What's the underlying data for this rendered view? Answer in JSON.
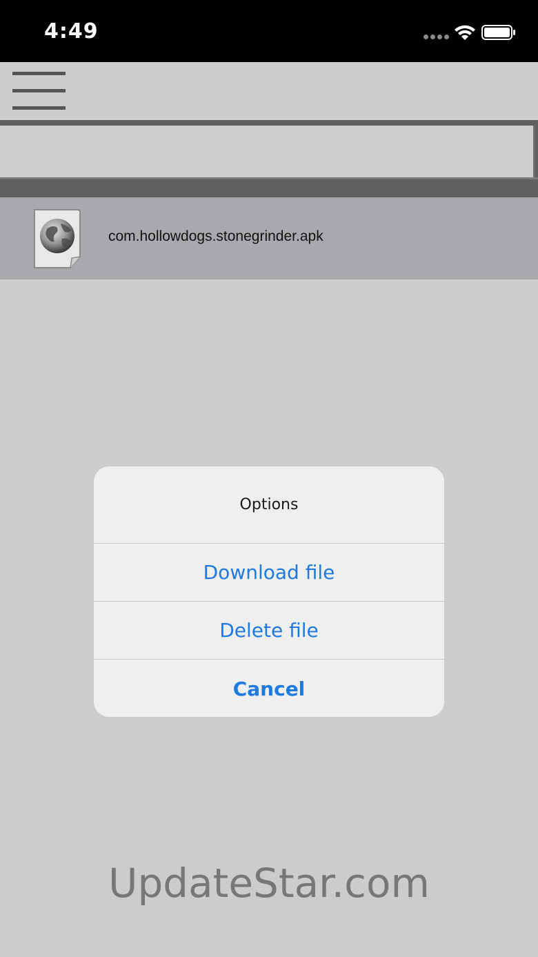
{
  "status_bar": {
    "time": "4:49",
    "icons": [
      "signal-icon",
      "wifi-icon",
      "battery-icon"
    ]
  },
  "toolbar": {
    "menu_icon": "hamburger-menu-icon"
  },
  "path_bar": {
    "value": ""
  },
  "file_list": [
    {
      "icon": "globe-file-icon",
      "name": "com.hollowdogs.stonegrinder.apk"
    }
  ],
  "dialog": {
    "title": "Options",
    "buttons": [
      "Download file",
      "Delete file",
      "Cancel"
    ]
  },
  "watermark": "UpdateStar.com",
  "colors": {
    "status_bar_bg": "#000000",
    "page_bg": "#cccccc",
    "row_bg": "#a9a9ad",
    "dialog_bg": "#efefef",
    "action_blue": "#1f7ae0",
    "watermark": "#777777"
  }
}
